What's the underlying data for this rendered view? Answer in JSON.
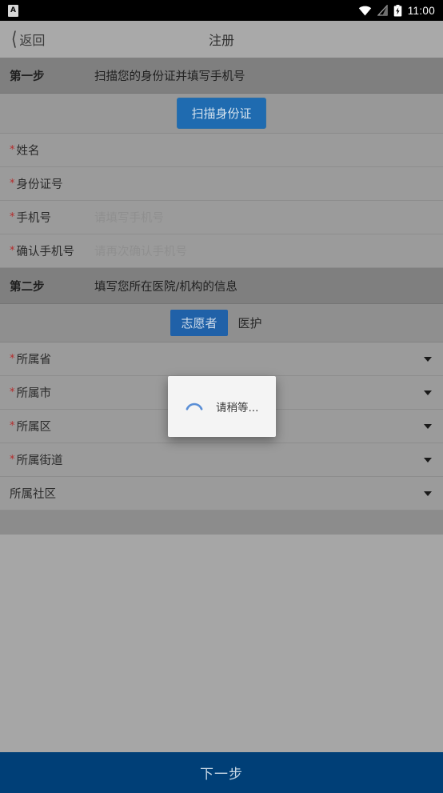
{
  "statusbar": {
    "app_icon_letter": "A",
    "time": "11:00",
    "icons": [
      "app-notification-icon",
      "wifi-icon",
      "signal-icon",
      "battery-charging-icon"
    ]
  },
  "navbar": {
    "back_label": "返回",
    "title": "注册"
  },
  "step_one": {
    "number": "第一步",
    "description": "扫描您的身份证并填写手机号",
    "scan_button": "扫描身份证",
    "fields": [
      {
        "required": true,
        "label": "姓名",
        "value": "",
        "placeholder": ""
      },
      {
        "required": true,
        "label": "身份证号",
        "value": "",
        "placeholder": ""
      },
      {
        "required": true,
        "label": "手机号",
        "value": "",
        "placeholder": "请填写手机号"
      },
      {
        "required": true,
        "label": "确认手机号",
        "value": "",
        "placeholder": "请再次确认手机号"
      }
    ]
  },
  "step_two": {
    "number": "第二步",
    "description": "填写您所在医院/机构的信息",
    "tabs": [
      {
        "label": "志愿者",
        "active": true
      },
      {
        "label": "医护",
        "active": false
      }
    ],
    "fields": [
      {
        "required": true,
        "label": "所属省",
        "value": ""
      },
      {
        "required": true,
        "label": "所属市",
        "value": ""
      },
      {
        "required": true,
        "label": "所属区",
        "value": ""
      },
      {
        "required": true,
        "label": "所属街道",
        "value": ""
      },
      {
        "required": false,
        "label": "所属社区",
        "value": ""
      }
    ]
  },
  "bottom_bar": {
    "next_label": "下一步"
  },
  "dialog": {
    "visible": true,
    "text": "请稍等...",
    "spinner_color": "#5b8fd6"
  },
  "colors": {
    "accent_blue": "#2061a8",
    "cta_blue": "#003f77",
    "required_star": "#b42b2b",
    "page_background": "#a6a6a6"
  }
}
